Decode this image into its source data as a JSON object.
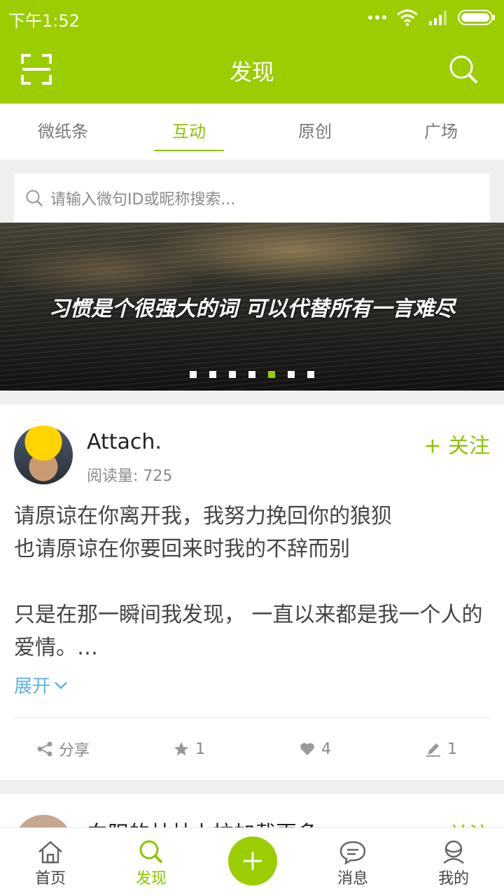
{
  "status_bar": {
    "time": "下午1:52",
    "icons": [
      "dots-icon",
      "wifi-icon",
      "signal-icon",
      "battery-icon"
    ]
  },
  "header": {
    "title": "发现",
    "left_icon": "scan-icon",
    "right_icon": "search-icon"
  },
  "tabs": [
    {
      "label": "微纸条",
      "active": false
    },
    {
      "label": "互动",
      "active": true
    },
    {
      "label": "原创",
      "active": false
    },
    {
      "label": "广场",
      "active": false
    }
  ],
  "search": {
    "placeholder": "请输入微句ID或昵称搜索..."
  },
  "banner": {
    "text": "习惯是个很强大的词 可以代替所有一言难尽",
    "slide_count": 7,
    "active_slide": 5
  },
  "post": {
    "author": "Attach.",
    "read_count": "阅读量: 725",
    "follow_label": "+ 关注",
    "text": "请原谅在你离开我，我努力挽回你的狼狈\n也请原谅在你要回来时我的不辞而别\n\n只是在那一瞬间我发现， 一直以来都是我一个人的爱情。…",
    "expand_label": "展开",
    "actions": {
      "share_label": "分享",
      "star_count": "1",
      "like_count": "4",
      "comment_count": "1"
    }
  },
  "next_post": {
    "author": "向阳的林林上拉加载更多",
    "follow_label": "+ 关注"
  },
  "bottom_nav": {
    "items": [
      {
        "label": "首页",
        "icon": "home-icon"
      },
      {
        "label": "发现",
        "icon": "discover-search-icon",
        "active": true
      },
      {
        "label": "",
        "icon": "plus-icon"
      },
      {
        "label": "消息",
        "icon": "message-icon"
      },
      {
        "label": "我的",
        "icon": "profile-icon"
      }
    ]
  },
  "colors": {
    "brand_green": "#9bcd00",
    "link_blue": "#5cb3ea"
  }
}
